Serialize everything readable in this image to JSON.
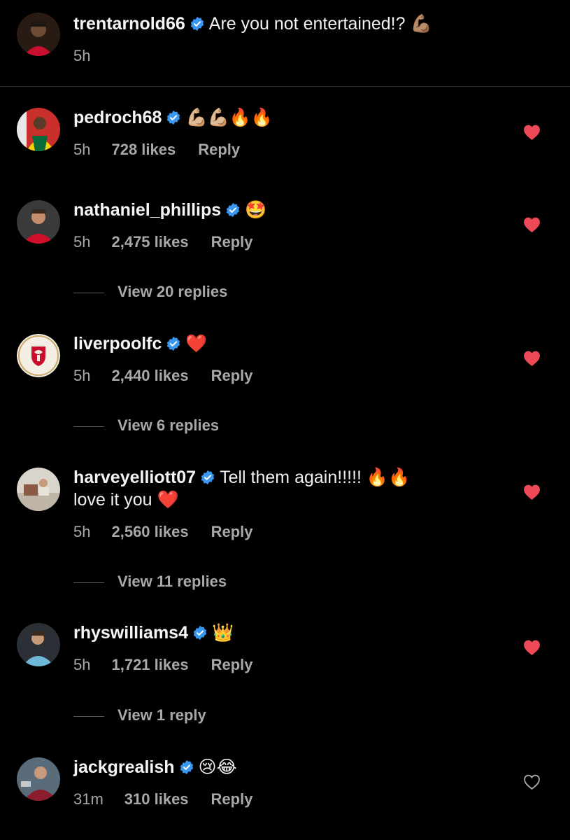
{
  "post": {
    "username": "trentarnold66",
    "caption": "Are you not entertained!? 💪🏽",
    "time": "5h"
  },
  "comments": [
    {
      "username": "pedroch68",
      "text": "💪🏼💪🏼🔥🔥",
      "time": "5h",
      "likes": "728 likes",
      "reply": "Reply",
      "liked": true
    },
    {
      "username": "nathaniel_phillips",
      "text": "🤩",
      "time": "5h",
      "likes": "2,475 likes",
      "reply": "Reply",
      "liked": true,
      "view_replies": "View 20 replies"
    },
    {
      "username": "liverpoolfc",
      "text": "❤️",
      "time": "5h",
      "likes": "2,440 likes",
      "reply": "Reply",
      "liked": true,
      "view_replies": "View 6 replies"
    },
    {
      "username": "harveyelliott07",
      "text": "Tell them again!!!!! 🔥🔥",
      "text_line2": "love it you ❤️",
      "time": "5h",
      "likes": "2,560 likes",
      "reply": "Reply",
      "liked": true,
      "view_replies": "View 11 replies"
    },
    {
      "username": "rhyswilliams4",
      "text": "👑",
      "time": "5h",
      "likes": "1,721 likes",
      "reply": "Reply",
      "liked": true,
      "view_replies": "View 1 reply"
    },
    {
      "username": "jackgrealish",
      "text": "😢😂",
      "time": "31m",
      "likes": "310 likes",
      "reply": "Reply",
      "liked": false
    }
  ],
  "colors": {
    "background": "#000000",
    "verified": "#3897f0",
    "liked_heart": "#ed4956",
    "secondary_text": "#a8a8a8"
  }
}
